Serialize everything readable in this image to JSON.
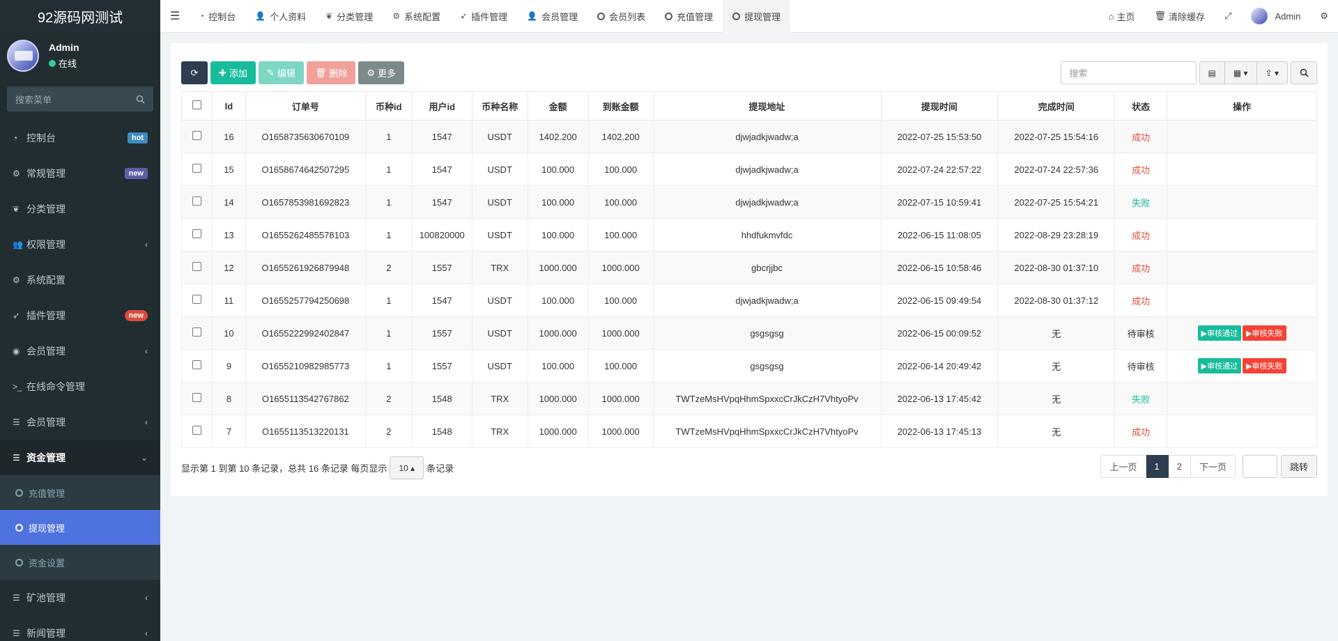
{
  "brand": "92源码网测试",
  "user": {
    "name": "Admin",
    "status": "在线"
  },
  "sidebar": {
    "search_placeholder": "搜索菜单",
    "items": [
      {
        "label": "控制台",
        "icon": "dashboard-icon",
        "badge": "hot"
      },
      {
        "label": "常规管理",
        "icon": "cogs-icon",
        "badge": "new"
      },
      {
        "label": "分类管理",
        "icon": "leaf-icon"
      },
      {
        "label": "权限管理",
        "icon": "group-icon",
        "chevron": "left"
      },
      {
        "label": "系统配置",
        "icon": "cog-icon"
      },
      {
        "label": "插件管理",
        "icon": "rocket-icon",
        "badge": "new"
      },
      {
        "label": "会员管理",
        "icon": "user-circle-icon",
        "chevron": "left"
      },
      {
        "label": "在线命令管理",
        "icon": "terminal-icon"
      },
      {
        "label": "会员管理",
        "icon": "list-icon",
        "chevron": "left"
      },
      {
        "label": "资金管理",
        "icon": "list-icon",
        "chevron": "down"
      }
    ],
    "submenu": [
      {
        "label": "充值管理"
      },
      {
        "label": "提现管理"
      },
      {
        "label": "资金设置"
      }
    ],
    "after": [
      {
        "label": "矿池管理",
        "icon": "list-icon",
        "chevron": "left"
      },
      {
        "label": "新闻管理",
        "icon": "list-icon",
        "chevron": "left"
      }
    ]
  },
  "navbar": {
    "tabs": [
      {
        "label": "控制台"
      },
      {
        "label": "个人资料"
      },
      {
        "label": "分类管理"
      },
      {
        "label": "系统配置"
      },
      {
        "label": "插件管理"
      },
      {
        "label": "会员管理"
      },
      {
        "label": "会员列表"
      },
      {
        "label": "充值管理"
      },
      {
        "label": "提现管理"
      }
    ],
    "home": "主页",
    "clear_cache": "清除缓存",
    "admin": "Admin"
  },
  "toolbar": {
    "add": "添加",
    "edit": "编辑",
    "delete": "删除",
    "more": "更多",
    "search_placeholder": "搜索"
  },
  "table": {
    "headers": [
      "Id",
      "订单号",
      "币种id",
      "用户id",
      "币种名称",
      "金额",
      "到账金额",
      "提现地址",
      "提现时间",
      "完成时间",
      "状态",
      "操作"
    ],
    "rows": [
      {
        "id": "16",
        "order": "O1658735630670109",
        "coin_id": "1",
        "uid": "1547",
        "coin": "USDT",
        "amount": "1402.200",
        "received": "1402.200",
        "addr": "djwjadkjwadw;a",
        "time": "2022-07-25 15:53:50",
        "done": "2022-07-25 15:54:16",
        "status": "成功",
        "status_type": "ok"
      },
      {
        "id": "15",
        "order": "O1658674642507295",
        "coin_id": "1",
        "uid": "1547",
        "coin": "USDT",
        "amount": "100.000",
        "received": "100.000",
        "addr": "djwjadkjwadw;a",
        "time": "2022-07-24 22:57:22",
        "done": "2022-07-24 22:57:36",
        "status": "成功",
        "status_type": "ok"
      },
      {
        "id": "14",
        "order": "O1657853981692823",
        "coin_id": "1",
        "uid": "1547",
        "coin": "USDT",
        "amount": "100.000",
        "received": "100.000",
        "addr": "djwjadkjwadw;a",
        "time": "2022-07-15 10:59:41",
        "done": "2022-07-25 15:54:21",
        "status": "失败",
        "status_type": "fail"
      },
      {
        "id": "13",
        "order": "O1655262485578103",
        "coin_id": "1",
        "uid": "100820000",
        "coin": "USDT",
        "amount": "100.000",
        "received": "100.000",
        "addr": "hhdfukmvfdc",
        "time": "2022-06-15 11:08:05",
        "done": "2022-08-29 23:28:19",
        "status": "成功",
        "status_type": "ok"
      },
      {
        "id": "12",
        "order": "O1655261926879948",
        "coin_id": "2",
        "uid": "1557",
        "coin": "TRX",
        "amount": "1000.000",
        "received": "1000.000",
        "addr": "gbcrjjbc",
        "time": "2022-06-15 10:58:46",
        "done": "2022-08-30 01:37:10",
        "status": "成功",
        "status_type": "ok"
      },
      {
        "id": "11",
        "order": "O1655257794250698",
        "coin_id": "1",
        "uid": "1547",
        "coin": "USDT",
        "amount": "100.000",
        "received": "100.000",
        "addr": "djwjadkjwadw;a",
        "time": "2022-06-15 09:49:54",
        "done": "2022-08-30 01:37:12",
        "status": "成功",
        "status_type": "ok"
      },
      {
        "id": "10",
        "order": "O1655222992402847",
        "coin_id": "1",
        "uid": "1557",
        "coin": "USDT",
        "amount": "1000.000",
        "received": "1000.000",
        "addr": "gsgsgsg",
        "time": "2022-06-15 00:09:52",
        "done": "无",
        "status": "待审核",
        "status_type": "pending"
      },
      {
        "id": "9",
        "order": "O1655210982985773",
        "coin_id": "1",
        "uid": "1557",
        "coin": "USDT",
        "amount": "100.000",
        "received": "100.000",
        "addr": "gsgsgsg",
        "time": "2022-06-14 20:49:42",
        "done": "无",
        "status": "待审核",
        "status_type": "pending"
      },
      {
        "id": "8",
        "order": "O1655113542767862",
        "coin_id": "2",
        "uid": "1548",
        "coin": "TRX",
        "amount": "1000.000",
        "received": "1000.000",
        "addr": "TWTzeMsHVpqHhmSpxxcCrJkCzH7VhtyoPv",
        "time": "2022-06-13 17:45:42",
        "done": "无",
        "status": "失败",
        "status_type": "fail"
      },
      {
        "id": "7",
        "order": "O1655113513220131",
        "coin_id": "2",
        "uid": "1548",
        "coin": "TRX",
        "amount": "1000.000",
        "received": "1000.000",
        "addr": "TWTzeMsHVpqHhmSpxxcCrJkCzH7VhtyoPv",
        "time": "2022-06-13 17:45:13",
        "done": "无",
        "status": "成功",
        "status_type": "ok"
      }
    ],
    "action_pass": "审核通过",
    "action_reject": "审核失败"
  },
  "footer": {
    "info": "显示第 1 到第 10 条记录，总共 16 条记录 每页显示",
    "page_size": "10",
    "suffix": "条记录"
  },
  "pager": {
    "prev": "上一页",
    "pages": [
      "1",
      "2"
    ],
    "current": "1",
    "next": "下一页",
    "jump": "跳转"
  }
}
